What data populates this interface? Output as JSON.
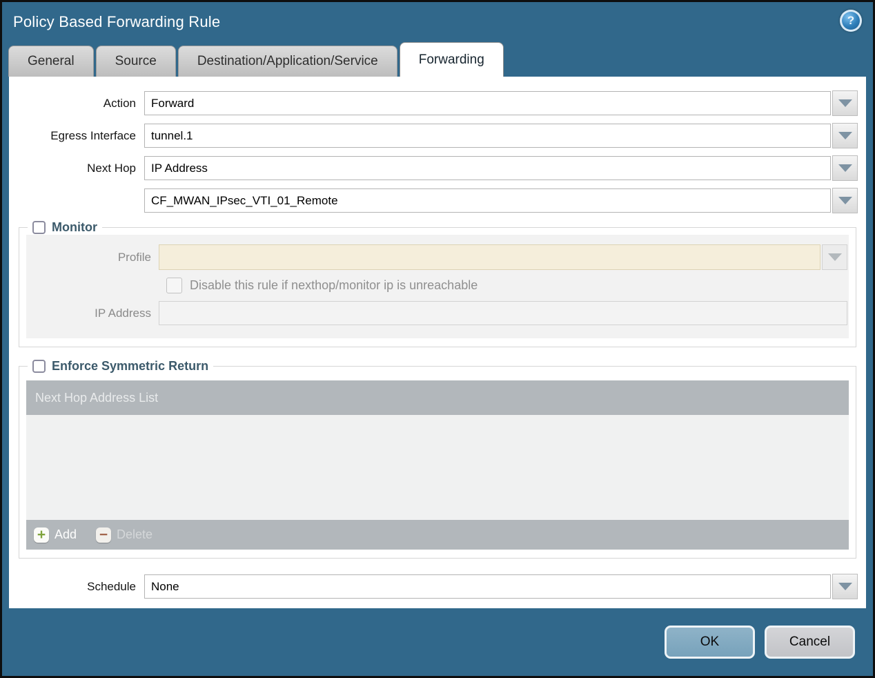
{
  "window": {
    "title": "Policy Based Forwarding Rule"
  },
  "icons": {
    "help": "?",
    "add": "+",
    "delete": "−"
  },
  "tabs": [
    {
      "label": "General",
      "active": false
    },
    {
      "label": "Source",
      "active": false
    },
    {
      "label": "Destination/Application/Service",
      "active": false
    },
    {
      "label": "Forwarding",
      "active": true
    }
  ],
  "form": {
    "action": {
      "label": "Action",
      "value": "Forward"
    },
    "egress_interface": {
      "label": "Egress Interface",
      "value": "tunnel.1"
    },
    "next_hop": {
      "label": "Next Hop",
      "value": "IP Address"
    },
    "next_hop_address": {
      "value": "CF_MWAN_IPsec_VTI_01_Remote"
    },
    "schedule": {
      "label": "Schedule",
      "value": "None"
    }
  },
  "monitor": {
    "legend": "Monitor",
    "checked": false,
    "profile": {
      "label": "Profile",
      "value": ""
    },
    "disable_rule": {
      "label": "Disable this rule if nexthop/monitor ip is unreachable",
      "checked": false
    },
    "ip_address": {
      "label": "IP Address",
      "value": ""
    }
  },
  "symmetric_return": {
    "legend": "Enforce Symmetric Return",
    "checked": false,
    "table": {
      "header": "Next Hop Address List",
      "rows": []
    },
    "add_label": "Add",
    "delete_label": "Delete"
  },
  "footer": {
    "ok": "OK",
    "cancel": "Cancel"
  },
  "colors": {
    "titlebar_teal": "#31688b",
    "active_tab_bg": "#ffffff",
    "inactive_tab_bg": "#c6c6c6",
    "legend_text": "#3c5a6b",
    "disabled_profile_bg": "#f5eedb",
    "table_header_bg": "#b2b7bb",
    "table_body_bg": "#f0f1f1",
    "ok_button_bg": "#7fa9c1",
    "cancel_button_bg": "#c9cacd",
    "add_icon_green": "#7fa33c",
    "delete_icon_red": "#a2654c",
    "dropdown_arrow": "#7e93a3"
  }
}
